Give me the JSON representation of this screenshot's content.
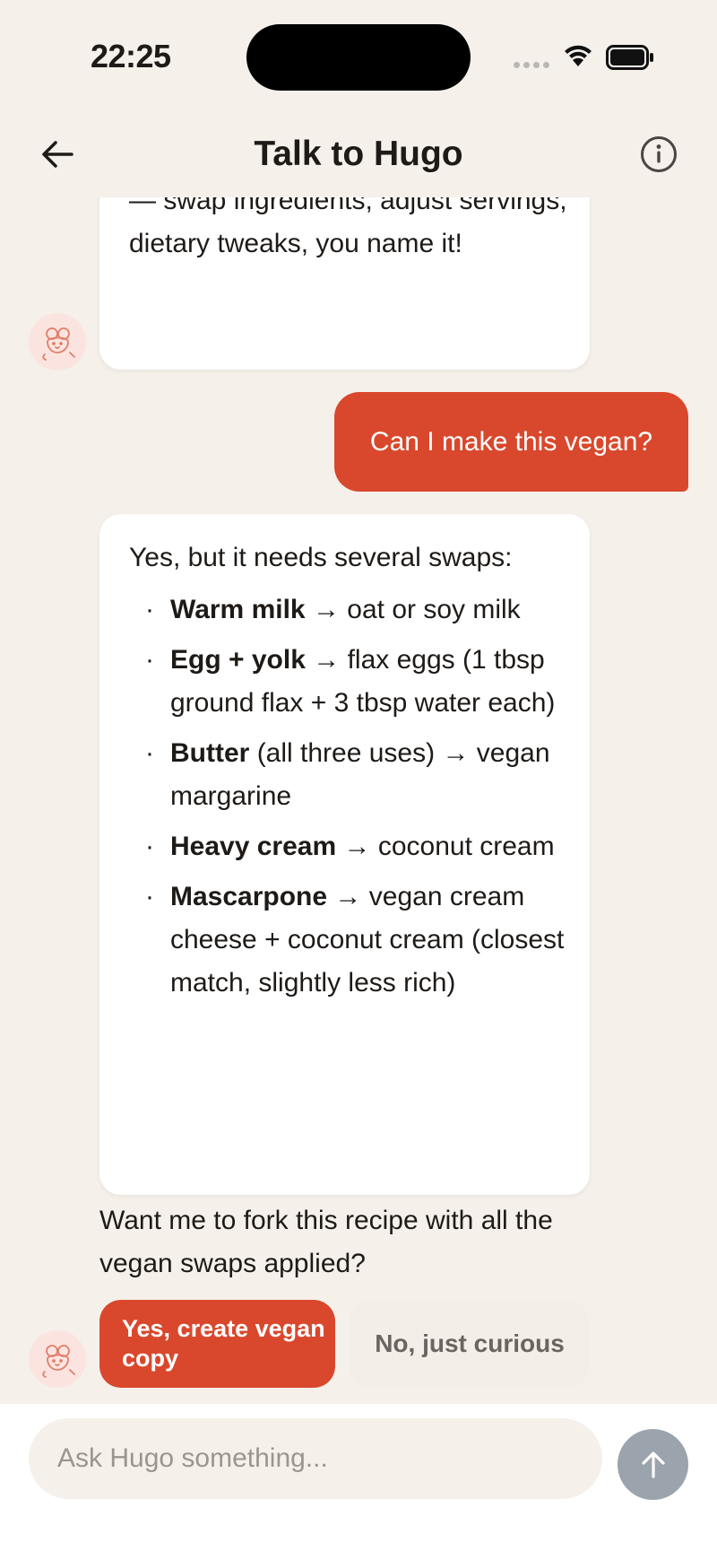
{
  "status_bar": {
    "time": "22:25"
  },
  "header": {
    "title": "Talk to Hugo",
    "back_icon": "arrow-left-icon",
    "info_icon": "info-circle-icon"
  },
  "messages": [
    {
      "from": "bot",
      "text": "— swap ingredients, adjust servings, dietary tweaks, you name it!"
    },
    {
      "from": "user",
      "text": "Can I make this vegan?"
    },
    {
      "from": "bot",
      "intro": "Yes, but it needs several swaps:",
      "swaps": [
        {
          "bullet": "·",
          "ingredient": "Warm milk",
          "note": "",
          "arrow": "→",
          "replacement": "oat or soy milk"
        },
        {
          "bullet": "·",
          "ingredient": "Egg + yolk",
          "note": "",
          "arrow": "→",
          "replacement": "flax eggs (1 tbsp ground flax + 3 tbsp water each)"
        },
        {
          "bullet": "·",
          "ingredient": "Butter",
          "note": "(all three uses)",
          "arrow": "→",
          "replacement": "vegan margarine"
        },
        {
          "bullet": "·",
          "ingredient": "Heavy cream",
          "note": "",
          "arrow": "→",
          "replacement": "coconut cream"
        },
        {
          "bullet": "·",
          "ingredient": "Mascarpone",
          "note": "",
          "arrow": "→",
          "replacement": "vegan cream cheese + coconut cream (closest match, slightly less rich)"
        }
      ]
    },
    {
      "from": "bot",
      "text": "Want me to fork this recipe with all the vegan swaps applied?"
    }
  ],
  "quick_replies": {
    "yes": "Yes, create vegan copy",
    "no": "No, just curious"
  },
  "input": {
    "placeholder": "Ask Hugo something...",
    "value": ""
  },
  "colors": {
    "accent": "#d9482c",
    "background": "#f5f0ea",
    "send_disabled": "#9ba3ad"
  }
}
